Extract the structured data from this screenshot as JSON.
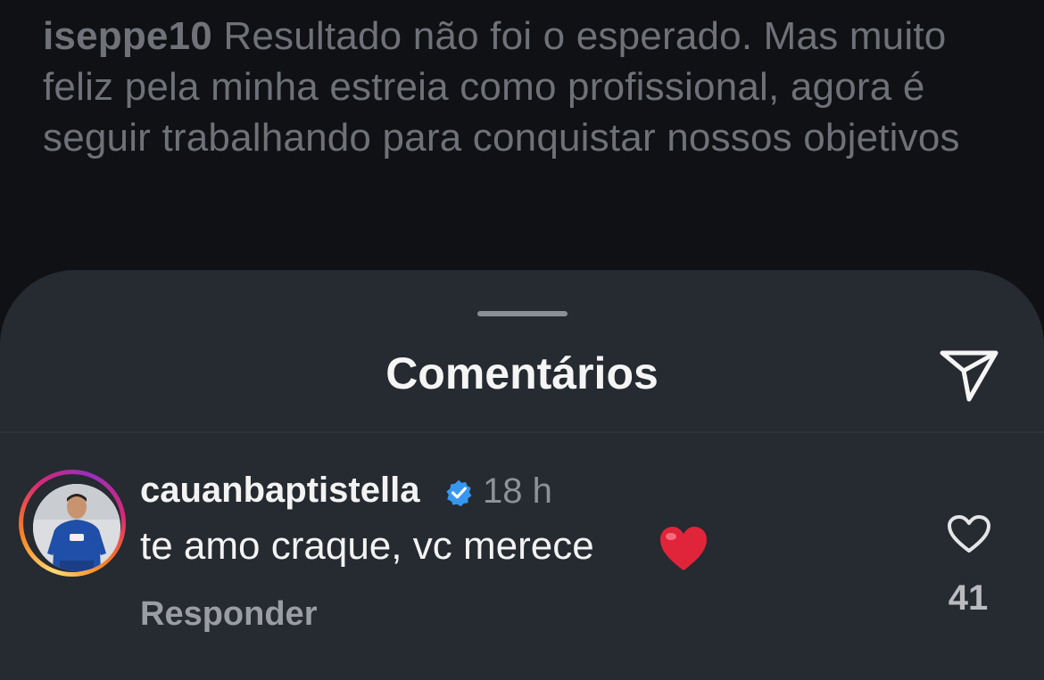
{
  "post": {
    "author": "iseppe10",
    "caption": "Resultado não foi o esperado. Mas muito feliz pela minha estreia como profissional, agora é seguir trabalhando para conquistar nossos objetivos"
  },
  "sheet": {
    "title": "Comentários",
    "share_icon": "send-icon"
  },
  "comments": [
    {
      "username": "cauanbaptistella",
      "verified": true,
      "time": "18 h",
      "text": "te amo craque, vc merece",
      "emoji": "red-heart-emoji",
      "reply_label": "Responder",
      "likes": "41",
      "like_icon": "heart-outline-icon"
    }
  ],
  "colors": {
    "background": "#0f1114",
    "sheet": "#262a31",
    "verified": "#3797f0",
    "heart": "#e0243a"
  }
}
